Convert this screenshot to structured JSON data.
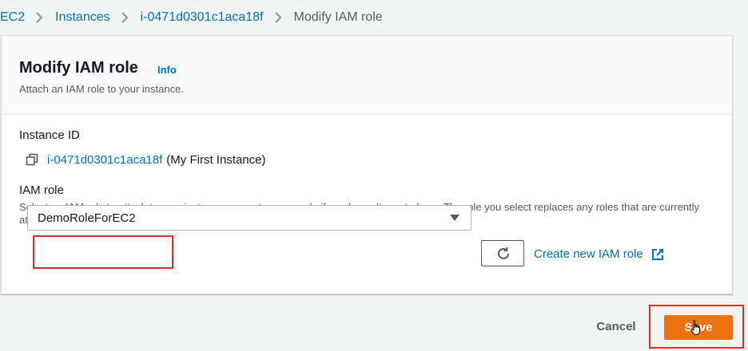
{
  "breadcrumb": {
    "items": [
      "EC2",
      "Instances",
      "i-0471d0301c1aca18f",
      "Modify IAM role"
    ]
  },
  "panel": {
    "title": "Modify IAM role",
    "info_label": "Info",
    "description": "Attach an IAM role to your instance."
  },
  "instance": {
    "label": "Instance ID",
    "id": "i-0471d0301c1aca18f",
    "name": "(My First Instance)"
  },
  "iam_role": {
    "label": "IAM role",
    "help_text": "Select an IAM role to attach to your instance or create a new role if you haven't created any. The role you select replaces any roles that are currently attached to your instance.",
    "selected_value": "DemoRoleForEC2",
    "create_link_label": "Create new IAM role"
  },
  "footer": {
    "cancel_label": "Cancel",
    "save_label": "Save"
  },
  "icons": {
    "breadcrumb_separator": "chevron-right-icon",
    "copy": "copy-icon",
    "dropdown": "caret-down-icon",
    "refresh": "refresh-icon",
    "external": "external-link-icon",
    "cursor": "hand-pointer-cursor-icon"
  },
  "colors": {
    "link": "#0073bb",
    "primary_button": "#ec7211",
    "highlight": "#e02d2d",
    "page_background": "#f2f3f3"
  }
}
